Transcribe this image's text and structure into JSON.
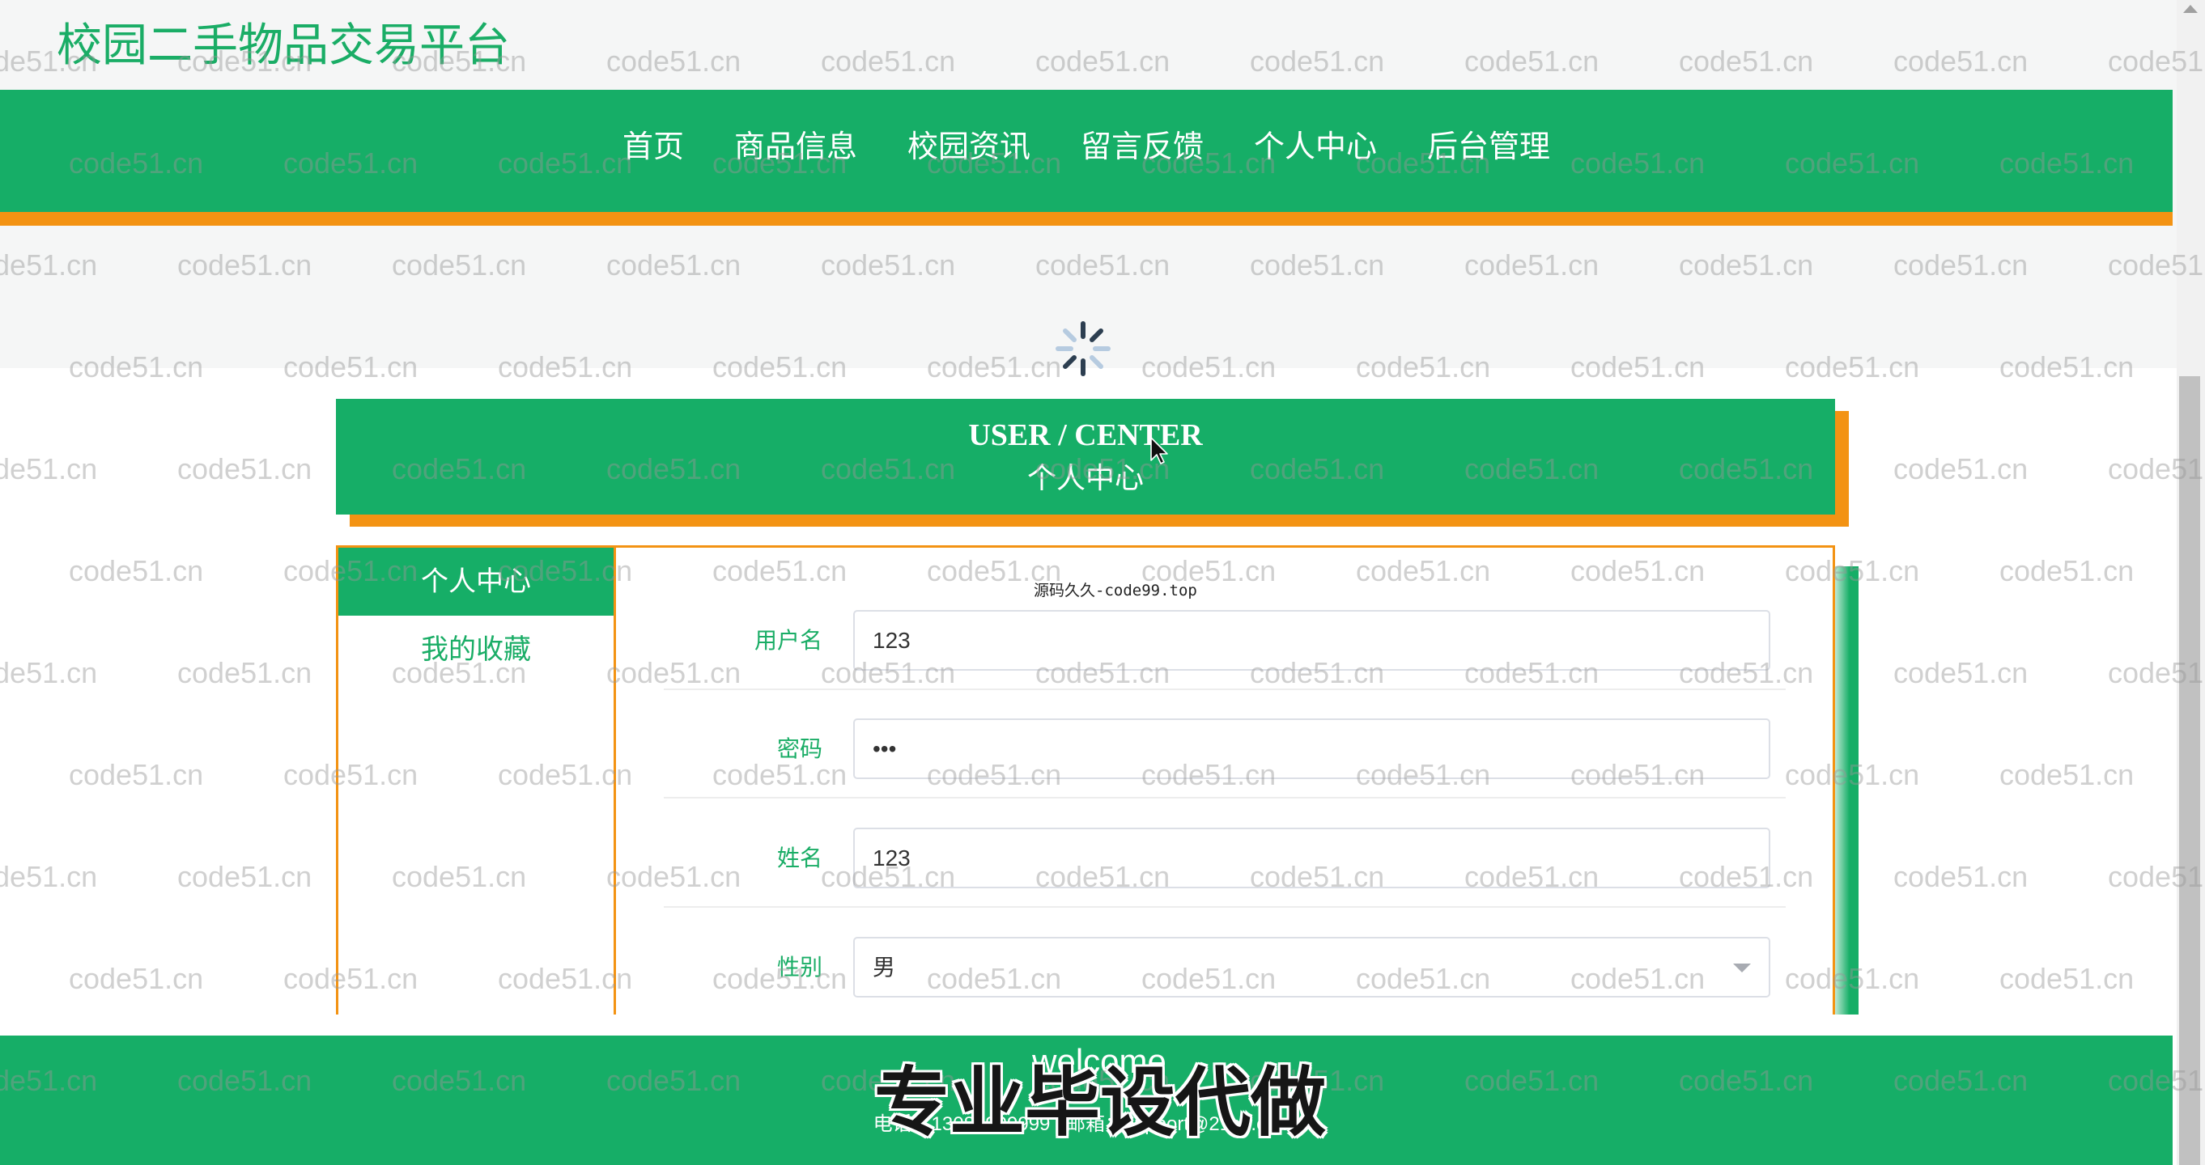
{
  "site": {
    "title": "校园二手物品交易平台"
  },
  "nav": {
    "items": [
      {
        "label": "首页"
      },
      {
        "label": "商品信息"
      },
      {
        "label": "校园资讯"
      },
      {
        "label": "留言反馈"
      },
      {
        "label": "个人中心"
      },
      {
        "label": "后台管理"
      }
    ]
  },
  "banner": {
    "title_en": "USER / CENTER",
    "title_cn": "个人中心"
  },
  "sidebar": {
    "items": [
      {
        "label": "个人中心",
        "active": true
      },
      {
        "label": "我的收藏",
        "active": false
      }
    ]
  },
  "form": {
    "fields": [
      {
        "label": "用户名",
        "value": "123"
      },
      {
        "label": "密码",
        "value": "•••"
      },
      {
        "label": "姓名",
        "value": "123"
      },
      {
        "label": "性别",
        "value": "男"
      }
    ]
  },
  "footer": {
    "welcome": "welcome",
    "contact": "电话：13088999999 | 邮箱：support@21cn.com"
  },
  "overlays": {
    "watermark_text": "code51.cn",
    "source_mark": "源码久久-code99.top",
    "promo_text": "专业毕设代做"
  },
  "icons": {
    "loading": "loading-spinner-icon",
    "dropdown": "chevron-down-icon",
    "cursor": "mouse-pointer-icon",
    "scroll_up": "scroll-up-arrow-icon"
  },
  "colors": {
    "primary": "#16ae67",
    "accent": "#f39313",
    "title_text": "#1aad66",
    "header_bg": "#f5f6f6"
  }
}
